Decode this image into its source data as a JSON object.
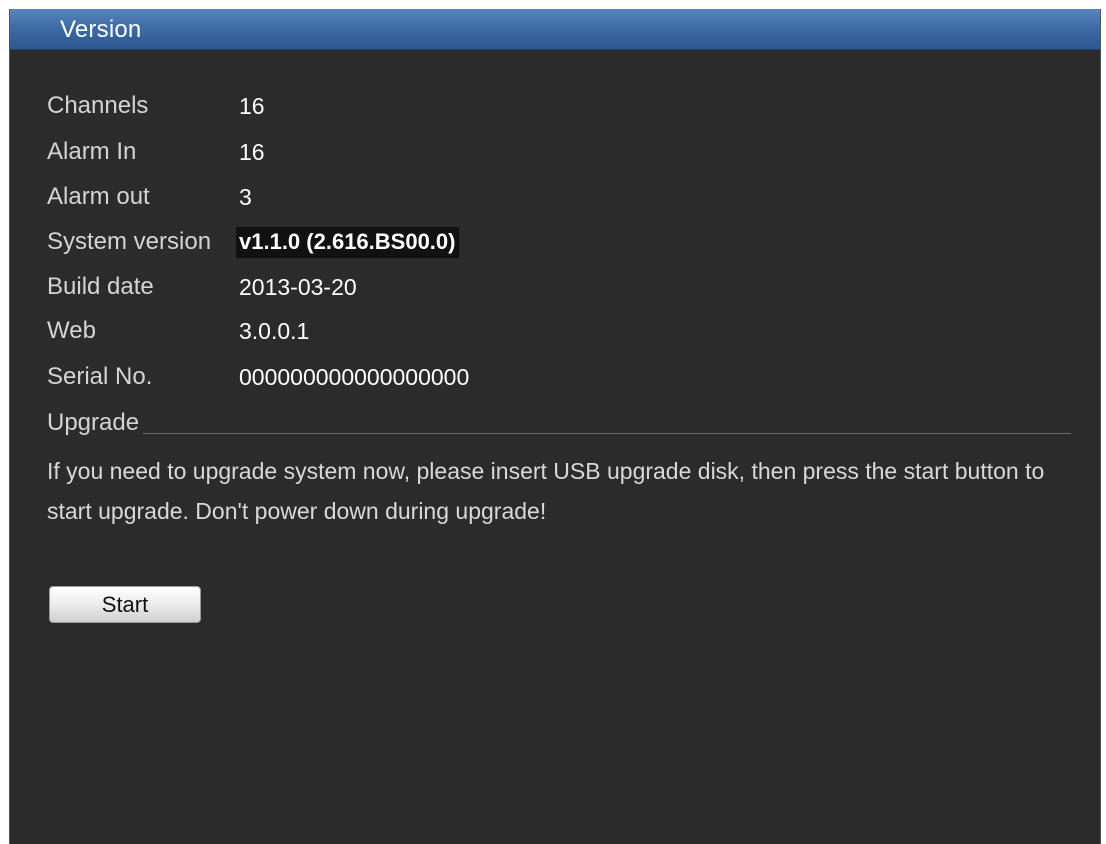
{
  "window": {
    "title": "Version"
  },
  "info": [
    {
      "label": "Channels",
      "value": "16"
    },
    {
      "label": "Alarm In",
      "value": "16"
    },
    {
      "label": "Alarm out",
      "value": "3"
    },
    {
      "label": "System version",
      "value": "v1.1.0 (2.616.BS00.0)"
    },
    {
      "label": "Build date",
      "value": "2013-03-20"
    },
    {
      "label": "Web",
      "value": "3.0.0.1"
    },
    {
      "label": "Serial No.",
      "value": "000000000000000000"
    }
  ],
  "upgrade": {
    "section_label": "Upgrade",
    "message": "If you need to upgrade system now, please insert USB upgrade disk, then press the start button to start upgrade. Don't power down during upgrade!",
    "start_label": "Start"
  },
  "colors": {
    "titlebar": "#3f6ba6",
    "background": "#2b2b2b",
    "text": "#d4d4d4",
    "value_text": "#ffffff",
    "highlight_bg": "#111111"
  }
}
